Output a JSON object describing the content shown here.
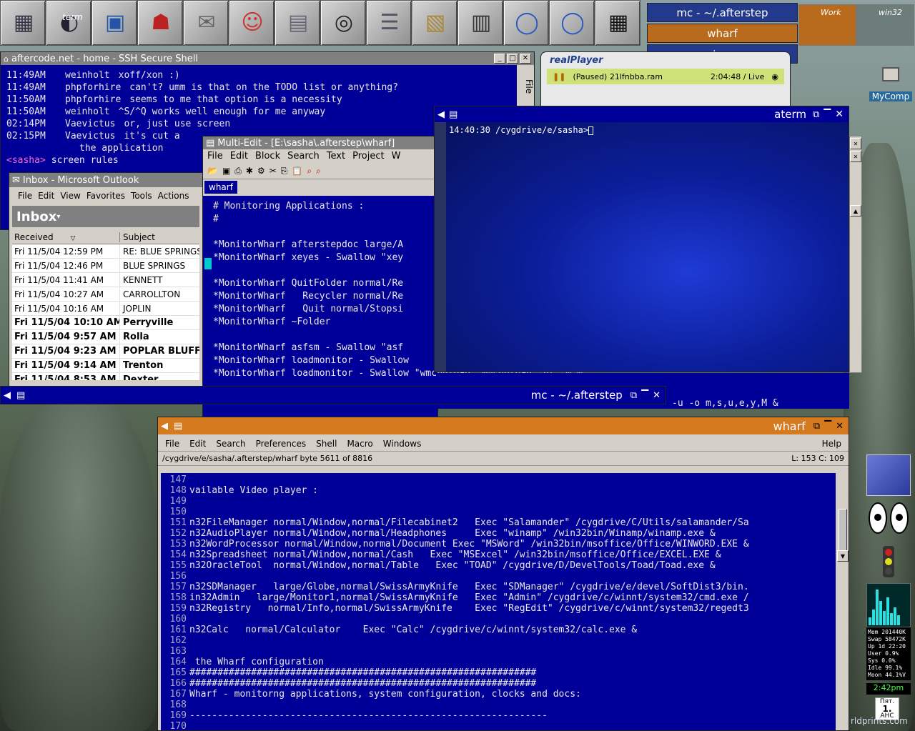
{
  "wharf_bar": {
    "icons": [
      "quit-icon",
      "term-icon",
      "monitor-icon",
      "mozilla-icon",
      "mailbox-icon",
      "irc-icon",
      "filecabinet-icon",
      "headphones-icon",
      "wordprocessor-icon",
      "image-icon",
      "spreadsheet-icon",
      "globe-knife-icon",
      "globe-knife-2-icon",
      "calculator-icon"
    ],
    "term_label": "term"
  },
  "pager": {
    "items": [
      "mc - ~/.afterstep",
      "wharf",
      "aterm"
    ],
    "desks": [
      "Work",
      "win32"
    ]
  },
  "desktop": {
    "mycomp_label": "MyComp"
  },
  "ssh": {
    "title": "aftercode.net - home - SSH Secure Shell",
    "side_tab": "File",
    "lines": [
      {
        "t": "11:49AM",
        "n": "weinholt",
        "m": "xoff/xon :)"
      },
      {
        "t": "11:49AM",
        "n": "phpforhire",
        "m": "can't? umm is that on the TODO list or anything?"
      },
      {
        "t": "11:50AM",
        "n": "phpforhire",
        "m": "seems to me that option is a necessity"
      },
      {
        "t": "11:50AM",
        "n": "weinholt",
        "m": "^S/^Q works well enough for me anyway"
      },
      {
        "t": "02:14PM",
        "n": "Vaevictus",
        "m": "or, just use screen"
      },
      {
        "t": "02:15PM",
        "n": "Vaevictus",
        "m": "it's cut a"
      },
      {
        "t": "",
        "n": "",
        "m": "the application"
      }
    ],
    "prompt_nick": "<sasha>",
    "prompt_text": "screen rules"
  },
  "outlook": {
    "title": "Inbox - Microsoft Outlook",
    "menu": [
      "File",
      "Edit",
      "View",
      "Favorites",
      "Tools",
      "Actions"
    ],
    "folder": "Inbox",
    "columns": [
      "Received",
      "Subject"
    ],
    "rows": [
      {
        "d": "Fri 11/5/04 12:59 PM",
        "s": "RE: BLUE SPRINGS",
        "b": false
      },
      {
        "d": "Fri 11/5/04 12:46 PM",
        "s": "BLUE SPRINGS",
        "b": false
      },
      {
        "d": "Fri 11/5/04 11:41 AM",
        "s": "KENNETT",
        "b": false
      },
      {
        "d": "Fri 11/5/04 10:27 AM",
        "s": "CARROLLTON",
        "b": false
      },
      {
        "d": "Fri 11/5/04 10:16 AM",
        "s": "JOPLIN",
        "b": false
      },
      {
        "d": "Fri 11/5/04 10:10 AM",
        "s": "Perryville",
        "b": true
      },
      {
        "d": "Fri 11/5/04 9:57 AM",
        "s": "Rolla",
        "b": true
      },
      {
        "d": "Fri 11/5/04 9:23 AM",
        "s": "POPLAR BLUFF",
        "b": true
      },
      {
        "d": "Fri 11/5/04 9:14 AM",
        "s": "Trenton",
        "b": true
      },
      {
        "d": "Fri 11/5/04 8:53 AM",
        "s": "Dexter",
        "b": true
      }
    ]
  },
  "multiedit": {
    "title": "Multi-Edit - [E:\\sasha\\.afterstep\\wharf]",
    "menu": [
      "File",
      "Edit",
      "Block",
      "Search",
      "Text",
      "Project",
      "W"
    ],
    "tab": "wharf",
    "lines": [
      "# Monitoring Applications :",
      "#",
      "",
      "*MonitorWharf afterstepdoc large/A",
      "*MonitorWharf xeyes - Swallow \"xey",
      "",
      "*MonitorWharf QuitFolder normal/Re",
      "*MonitorWharf   Recycler normal/Re",
      "*MonitorWharf   Quit normal/Stopsi",
      "*MonitorWharf ~Folder",
      "",
      "*MonitorWharf asfsm - Swallow \"asf",
      "*MonitorWharf loadmonitor - Swallow",
      "*MonitorWharf loadmonitor - Swallow \"wmcpuload\" wmcpuload -bl -w &"
    ],
    "hidden_line": "-u -o m,s,u,e,y,M &"
  },
  "realplayer": {
    "brand": "realPlayer",
    "clip": "(Paused) 21lfnbba.ram",
    "time": "2:04:48 / Live"
  },
  "aterm": {
    "title": "aterm",
    "prompt": "14:40:30 /cygdrive/e/sasha>"
  },
  "mc_bar": {
    "title": "mc - ~/.afterstep"
  },
  "wharf_win": {
    "title": "wharf",
    "menu": [
      "File",
      "Edit",
      "Search",
      "Preferences",
      "Shell",
      "Macro",
      "Windows"
    ],
    "help": "Help",
    "status_left": "/cygdrive/e/sasha/.afterstep/wharf byte 5611 of 8816",
    "status_right": "L: 153  C: 109",
    "lines": [
      {
        "n": "147",
        "t": ""
      },
      {
        "n": "148",
        "t": "vailable Video player :"
      },
      {
        "n": "149",
        "t": ""
      },
      {
        "n": "150",
        "t": ""
      },
      {
        "n": "151",
        "t": "n32FileManager normal/Window,normal/Filecabinet2   Exec \"Salamander\" /cygdrive/C/Utils/salamander/Sa"
      },
      {
        "n": "152",
        "t": "n32AudioPlayer normal/Window,normal/Headphones     Exec \"winamp\" /win32bin/Winamp/winamp.exe &"
      },
      {
        "n": "153",
        "t": "n32WordProcessor normal/Window,normal/Document Exec \"MSWord\" /win32bin/msoffice/Office/WINWORD.EXE &"
      },
      {
        "n": "154",
        "t": "n32Spreadsheet normal/Window,normal/Cash   Exec \"MSExcel\" /win32bin/msoffice/Office/EXCEL.EXE &"
      },
      {
        "n": "155",
        "t": "n32OracleTool  normal/Window,normal/Table   Exec \"TOAD\" /cygdrive/D/DevelTools/Toad/Toad.exe &"
      },
      {
        "n": "156",
        "t": ""
      },
      {
        "n": "157",
        "t": "n32SDManager   large/Globe,normal/SwissArmyKnife   Exec \"SDManager\" /cygdrive/e/devel/SoftDist3/bin."
      },
      {
        "n": "158",
        "t": "in32Admin   large/Monitor1,normal/SwissArmyKnife   Exec \"Admin\" /cygdrive/c/winnt/system32/cmd.exe /"
      },
      {
        "n": "159",
        "t": "n32Registry   normal/Info,normal/SwissArmyKnife    Exec \"RegEdit\" /cygdrive/c/winnt/system32/regedt3"
      },
      {
        "n": "160",
        "t": ""
      },
      {
        "n": "161",
        "t": "n32Calc   normal/Calculator    Exec \"Calc\" /cygdrive/c/winnt/system32/calc.exe &"
      },
      {
        "n": "162",
        "t": ""
      },
      {
        "n": "163",
        "t": ""
      },
      {
        "n": "164",
        "t": " the Wharf configuration"
      },
      {
        "n": "165",
        "t": "##############################################################"
      },
      {
        "n": "166",
        "t": "##############################################################"
      },
      {
        "n": "167",
        "t": "Wharf - monitorng applications, system configuration, clocks and docs:"
      },
      {
        "n": "168",
        "t": ""
      },
      {
        "n": "169",
        "t": "----------------------------------------------------------------"
      },
      {
        "n": "170",
        "t": ""
      }
    ]
  },
  "dock": {
    "stats": [
      "Mem 201440K",
      "Swap 58472K",
      "Up 1d 22:20",
      "User 0.9%",
      "Sys 0.0%",
      "Idle 99.1%",
      "Moon 44.1%V"
    ],
    "clock": "2:42pm",
    "cal_day": "Пят.",
    "cal_date": "1.",
    "cal_month": "АНС",
    "watermark": "rldprints.com"
  },
  "colors": {
    "term_bg": "#000099",
    "active_title": "#000099",
    "orange_title": "#d57a1e"
  }
}
